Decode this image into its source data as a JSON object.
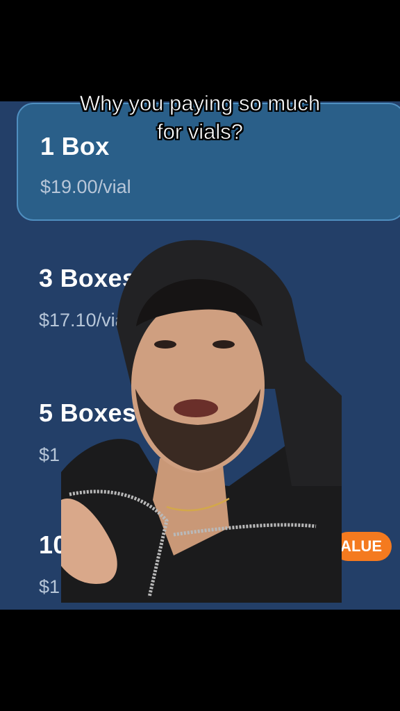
{
  "caption": {
    "line1": "Why you paying so much",
    "line2": "for vials?"
  },
  "options": [
    {
      "label": "1 Box",
      "price": "$19.00/vial",
      "selected": true
    },
    {
      "label": "3 Boxes",
      "price": "$17.10/vial"
    },
    {
      "label": "5 Boxes",
      "price": "$1"
    },
    {
      "label": "10",
      "price": "$1"
    }
  ],
  "badge": {
    "label": "ALUE"
  },
  "colors": {
    "app_background": "#233f68",
    "selected_card": "#2a5f89",
    "selected_border": "#4f8fc0",
    "badge": "#f47a1f",
    "letterbox": "#000000"
  },
  "icons": {
    "presenter": "person-with-hoodie-cutout"
  }
}
